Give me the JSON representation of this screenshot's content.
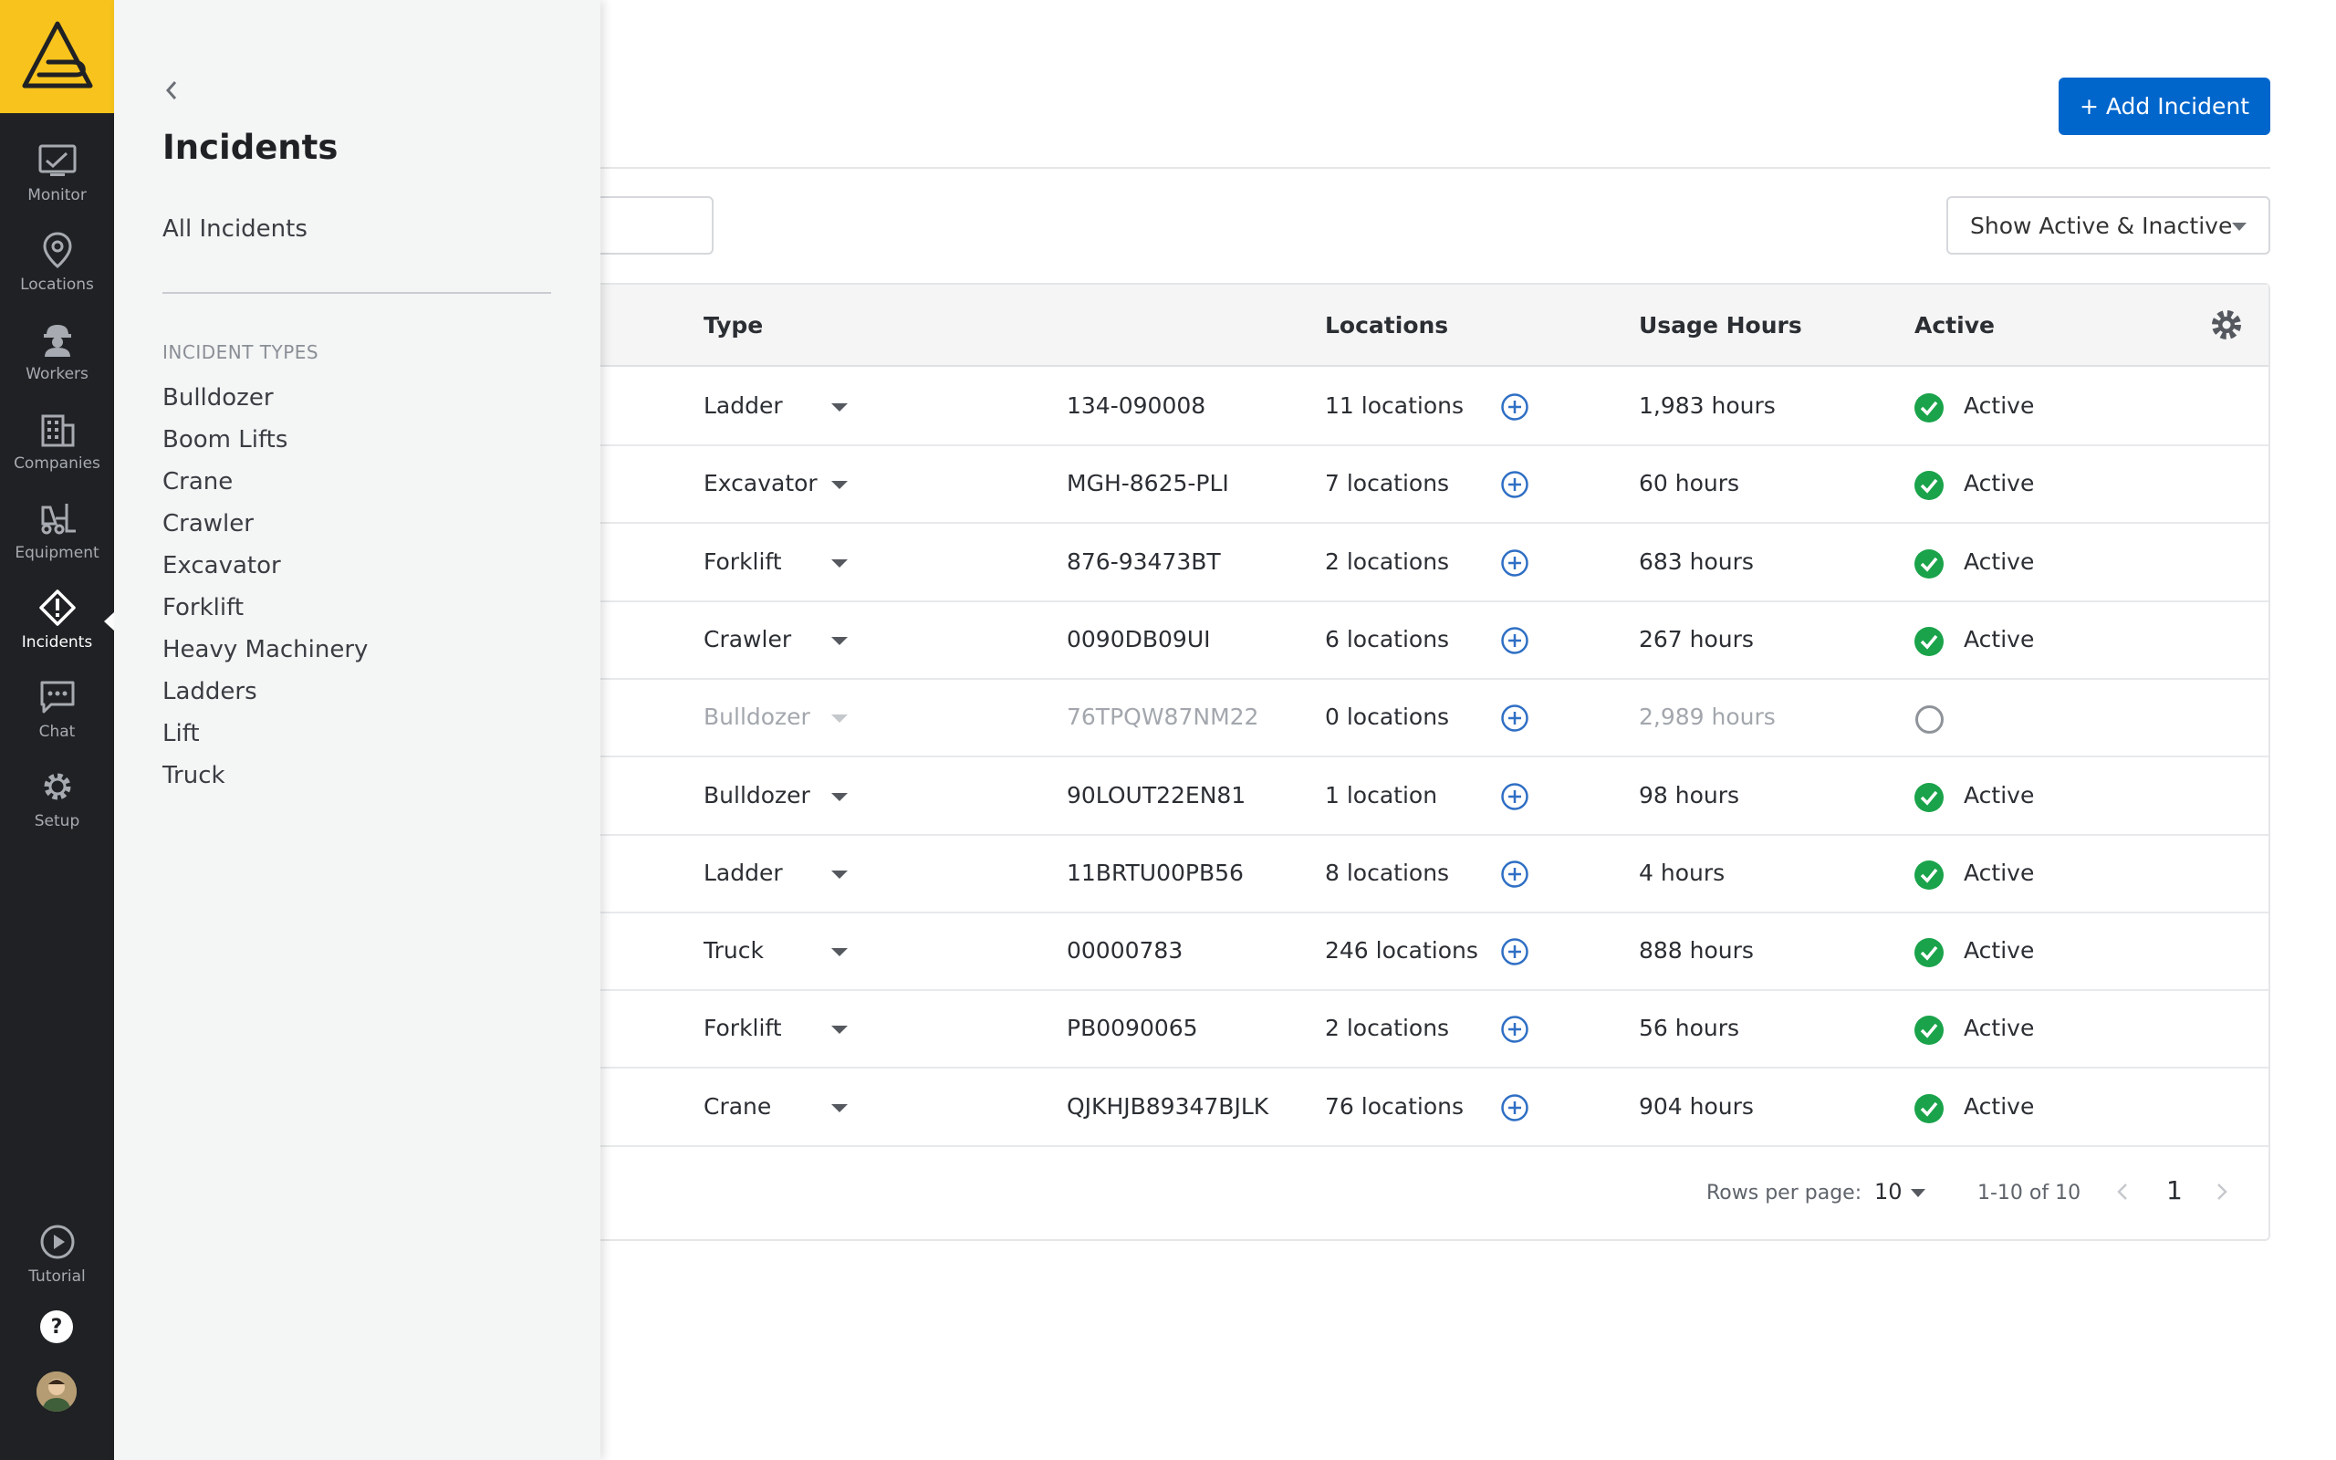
{
  "rail": {
    "items": [
      {
        "label": "Monitor",
        "icon": "monitor-icon"
      },
      {
        "label": "Locations",
        "icon": "location-pin-icon"
      },
      {
        "label": "Workers",
        "icon": "worker-icon"
      },
      {
        "label": "Companies",
        "icon": "building-icon"
      },
      {
        "label": "Equipment",
        "icon": "forklift-icon"
      },
      {
        "label": "Incidents",
        "icon": "warning-diamond-icon"
      },
      {
        "label": "Chat",
        "icon": "chat-bubble-icon"
      },
      {
        "label": "Setup",
        "icon": "gear-icon"
      }
    ],
    "tutorial": "Tutorial",
    "help": "?"
  },
  "flyout": {
    "title": "Incidents",
    "all_link": "All Incidents",
    "section_label": "INCIDENT TYPES",
    "types": [
      "Bulldozer",
      "Boom Lifts",
      "Crane",
      "Crawler",
      "Excavator",
      "Forklift",
      "Heavy Machinery",
      "Ladders",
      "Lift",
      "Truck"
    ]
  },
  "header": {
    "add_button": "+ Add Incident",
    "filter_label": "Show Active & Inactive"
  },
  "table": {
    "columns": {
      "type": "Type",
      "locations": "Locations",
      "usage": "Usage Hours",
      "active": "Active"
    },
    "rows": [
      {
        "type": "Ladder",
        "id": "134-090008",
        "locations": "11 locations",
        "usage": "1,983 hours",
        "status": "Active"
      },
      {
        "type": "Excavator",
        "id": "MGH-8625-PLI",
        "locations": "7 locations",
        "usage": "60 hours",
        "status": "Active"
      },
      {
        "type": "Forklift",
        "id": "876-93473BT",
        "locations": "2 locations",
        "usage": "683 hours",
        "status": "Active"
      },
      {
        "type": "Crawler",
        "id": "0090DB09UI",
        "locations": "6 locations",
        "usage": "267 hours",
        "status": "Active"
      },
      {
        "type": "Bulldozer",
        "id": "76TPQW87NM22",
        "locations": "0 locations",
        "usage": "2,989 hours",
        "status": ""
      },
      {
        "type": "Bulldozer",
        "id": "90LOUT22EN81",
        "locations": "1 location",
        "usage": "98 hours",
        "status": "Active"
      },
      {
        "type": "Ladder",
        "id": "11BRTU00PB56",
        "locations": "8 locations",
        "usage": "4 hours",
        "status": "Active"
      },
      {
        "type": "Truck",
        "id": "00000783",
        "locations": "246 locations",
        "usage": "888 hours",
        "status": "Active"
      },
      {
        "type": "Forklift",
        "id": "PB0090065",
        "locations": "2 locations",
        "usage": "56 hours",
        "status": "Active"
      },
      {
        "type": "Crane",
        "id": "QJKHJB89347BJLK",
        "locations": "76 locations",
        "usage": "904 hours",
        "status": "Active"
      }
    ]
  },
  "pagination": {
    "rows_per_page_label": "Rows per page:",
    "rows_per_page": "10",
    "range": "1-10 of 10",
    "page": "1"
  },
  "colors": {
    "brand": "#f7c31c",
    "rail_bg": "#1f2124",
    "primary": "#0066cc",
    "active_green": "#1aa34a"
  }
}
